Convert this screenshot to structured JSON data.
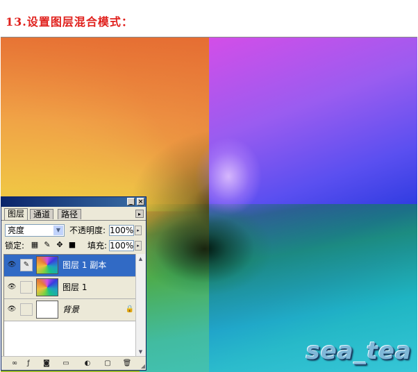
{
  "header": {
    "step_title": "13.设置图层混合模式："
  },
  "canvas": {
    "watermark": "sea_tea"
  },
  "layers_panel": {
    "titlebar_buttons": {
      "minimize": "_",
      "close": "×"
    },
    "tabs": [
      {
        "label": "图层",
        "active": true
      },
      {
        "label": "通道",
        "active": false
      },
      {
        "label": "路径",
        "active": false
      }
    ],
    "tab_menu_icon": "▸",
    "blend_mode": {
      "value": "亮度",
      "arrow": "▼"
    },
    "opacity": {
      "label": "不透明度:",
      "value": "100%",
      "arrow": "▸"
    },
    "lock": {
      "label": "锁定:",
      "icons": [
        "transparency-lock-icon",
        "brush-lock-icon",
        "move-lock-icon",
        "all-lock-icon"
      ]
    },
    "fill": {
      "label": "填充:",
      "value": "100%",
      "arrow": "▸"
    },
    "layers": [
      {
        "name": "图层 1 副本",
        "selected": true,
        "visible": true,
        "thumb": "rainbow"
      },
      {
        "name": "图层 1",
        "selected": false,
        "visible": true,
        "thumb": "rainbow"
      },
      {
        "name": "背景",
        "selected": false,
        "visible": true,
        "thumb": "white",
        "locked": true
      }
    ],
    "bottom_buttons": [
      "link-icon",
      "layer-style-icon",
      "mask-icon",
      "new-group-icon",
      "adjustment-layer-icon",
      "new-layer-icon",
      "trash-icon"
    ]
  },
  "colors": {
    "selected_layer": "#316ac5",
    "panel_bg": "#ece9d8",
    "title_red": "#e0201c"
  }
}
